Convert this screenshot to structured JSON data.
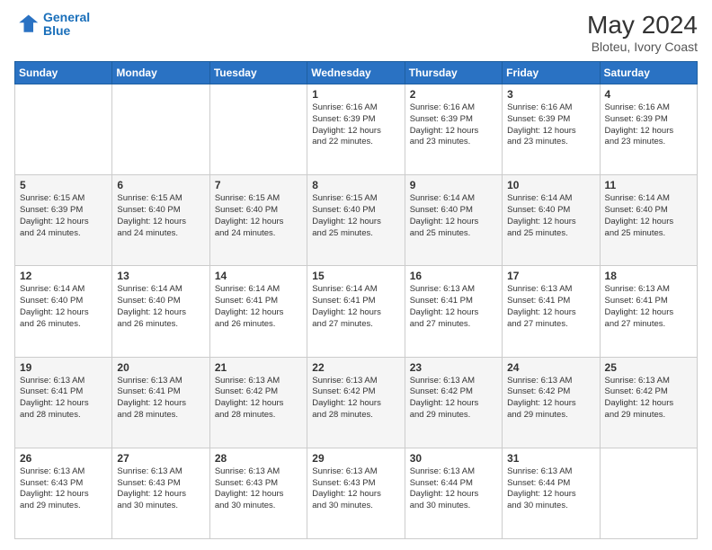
{
  "header": {
    "logo_line1": "General",
    "logo_line2": "Blue",
    "main_title": "May 2024",
    "subtitle": "Bloteu, Ivory Coast"
  },
  "columns": [
    "Sunday",
    "Monday",
    "Tuesday",
    "Wednesday",
    "Thursday",
    "Friday",
    "Saturday"
  ],
  "weeks": [
    {
      "days": [
        {
          "num": "",
          "info": ""
        },
        {
          "num": "",
          "info": ""
        },
        {
          "num": "",
          "info": ""
        },
        {
          "num": "1",
          "info": "Sunrise: 6:16 AM\nSunset: 6:39 PM\nDaylight: 12 hours\nand 22 minutes."
        },
        {
          "num": "2",
          "info": "Sunrise: 6:16 AM\nSunset: 6:39 PM\nDaylight: 12 hours\nand 23 minutes."
        },
        {
          "num": "3",
          "info": "Sunrise: 6:16 AM\nSunset: 6:39 PM\nDaylight: 12 hours\nand 23 minutes."
        },
        {
          "num": "4",
          "info": "Sunrise: 6:16 AM\nSunset: 6:39 PM\nDaylight: 12 hours\nand 23 minutes."
        }
      ]
    },
    {
      "days": [
        {
          "num": "5",
          "info": "Sunrise: 6:15 AM\nSunset: 6:39 PM\nDaylight: 12 hours\nand 24 minutes."
        },
        {
          "num": "6",
          "info": "Sunrise: 6:15 AM\nSunset: 6:40 PM\nDaylight: 12 hours\nand 24 minutes."
        },
        {
          "num": "7",
          "info": "Sunrise: 6:15 AM\nSunset: 6:40 PM\nDaylight: 12 hours\nand 24 minutes."
        },
        {
          "num": "8",
          "info": "Sunrise: 6:15 AM\nSunset: 6:40 PM\nDaylight: 12 hours\nand 25 minutes."
        },
        {
          "num": "9",
          "info": "Sunrise: 6:14 AM\nSunset: 6:40 PM\nDaylight: 12 hours\nand 25 minutes."
        },
        {
          "num": "10",
          "info": "Sunrise: 6:14 AM\nSunset: 6:40 PM\nDaylight: 12 hours\nand 25 minutes."
        },
        {
          "num": "11",
          "info": "Sunrise: 6:14 AM\nSunset: 6:40 PM\nDaylight: 12 hours\nand 25 minutes."
        }
      ]
    },
    {
      "days": [
        {
          "num": "12",
          "info": "Sunrise: 6:14 AM\nSunset: 6:40 PM\nDaylight: 12 hours\nand 26 minutes."
        },
        {
          "num": "13",
          "info": "Sunrise: 6:14 AM\nSunset: 6:40 PM\nDaylight: 12 hours\nand 26 minutes."
        },
        {
          "num": "14",
          "info": "Sunrise: 6:14 AM\nSunset: 6:41 PM\nDaylight: 12 hours\nand 26 minutes."
        },
        {
          "num": "15",
          "info": "Sunrise: 6:14 AM\nSunset: 6:41 PM\nDaylight: 12 hours\nand 27 minutes."
        },
        {
          "num": "16",
          "info": "Sunrise: 6:13 AM\nSunset: 6:41 PM\nDaylight: 12 hours\nand 27 minutes."
        },
        {
          "num": "17",
          "info": "Sunrise: 6:13 AM\nSunset: 6:41 PM\nDaylight: 12 hours\nand 27 minutes."
        },
        {
          "num": "18",
          "info": "Sunrise: 6:13 AM\nSunset: 6:41 PM\nDaylight: 12 hours\nand 27 minutes."
        }
      ]
    },
    {
      "days": [
        {
          "num": "19",
          "info": "Sunrise: 6:13 AM\nSunset: 6:41 PM\nDaylight: 12 hours\nand 28 minutes."
        },
        {
          "num": "20",
          "info": "Sunrise: 6:13 AM\nSunset: 6:41 PM\nDaylight: 12 hours\nand 28 minutes."
        },
        {
          "num": "21",
          "info": "Sunrise: 6:13 AM\nSunset: 6:42 PM\nDaylight: 12 hours\nand 28 minutes."
        },
        {
          "num": "22",
          "info": "Sunrise: 6:13 AM\nSunset: 6:42 PM\nDaylight: 12 hours\nand 28 minutes."
        },
        {
          "num": "23",
          "info": "Sunrise: 6:13 AM\nSunset: 6:42 PM\nDaylight: 12 hours\nand 29 minutes."
        },
        {
          "num": "24",
          "info": "Sunrise: 6:13 AM\nSunset: 6:42 PM\nDaylight: 12 hours\nand 29 minutes."
        },
        {
          "num": "25",
          "info": "Sunrise: 6:13 AM\nSunset: 6:42 PM\nDaylight: 12 hours\nand 29 minutes."
        }
      ]
    },
    {
      "days": [
        {
          "num": "26",
          "info": "Sunrise: 6:13 AM\nSunset: 6:43 PM\nDaylight: 12 hours\nand 29 minutes."
        },
        {
          "num": "27",
          "info": "Sunrise: 6:13 AM\nSunset: 6:43 PM\nDaylight: 12 hours\nand 30 minutes."
        },
        {
          "num": "28",
          "info": "Sunrise: 6:13 AM\nSunset: 6:43 PM\nDaylight: 12 hours\nand 30 minutes."
        },
        {
          "num": "29",
          "info": "Sunrise: 6:13 AM\nSunset: 6:43 PM\nDaylight: 12 hours\nand 30 minutes."
        },
        {
          "num": "30",
          "info": "Sunrise: 6:13 AM\nSunset: 6:44 PM\nDaylight: 12 hours\nand 30 minutes."
        },
        {
          "num": "31",
          "info": "Sunrise: 6:13 AM\nSunset: 6:44 PM\nDaylight: 12 hours\nand 30 minutes."
        },
        {
          "num": "",
          "info": ""
        }
      ]
    }
  ]
}
